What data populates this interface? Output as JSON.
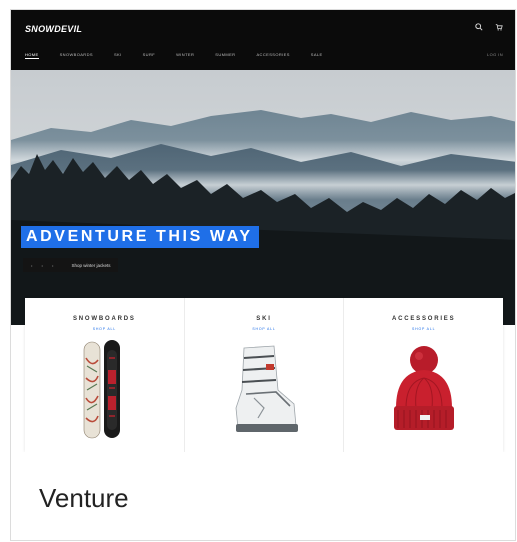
{
  "store": {
    "logo": "SNOWDEVIL",
    "nav": [
      "Home",
      "Snowboards",
      "Ski",
      "Surf",
      "Winter",
      "Summer",
      "Accessories",
      "Sale"
    ],
    "nav_right": "Log in"
  },
  "hero": {
    "headline": "ADVENTURE THIS WAY",
    "cta_dots": "• • •",
    "cta_label": "Shop winter jackets"
  },
  "collections": [
    {
      "title": "SNOWBOARDS",
      "link": "Shop all"
    },
    {
      "title": "SKI",
      "link": "Shop all"
    },
    {
      "title": "ACCESSORIES",
      "link": "Shop all"
    }
  ],
  "theme": {
    "name": "Venture"
  },
  "colors": {
    "accent": "#1f6fe8",
    "header_bg": "#0b0b0b",
    "beanie": "#c9202e"
  },
  "icons": {
    "search": "search-icon",
    "cart": "cart-icon"
  }
}
